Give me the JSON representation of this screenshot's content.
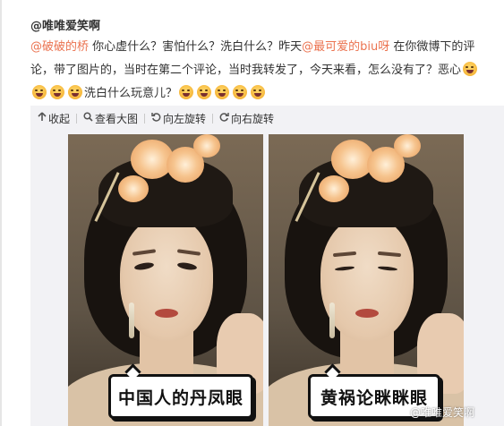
{
  "post": {
    "author": "@唯唯爱笑啊",
    "content": {
      "mention_1": "@破破的桥",
      "text_1": " 你心虚什么？害怕什么？洗白什么？昨天",
      "mention_2": "@最可爱的biu呀",
      "text_2": " 在你微博下的评论，带了图片的，当时在第二个评论，当时我转发了，今天来看，怎么没有了？恶心",
      "text_3": "洗白什么玩意儿？",
      "emoji_name": "vomit-face-emoji"
    }
  },
  "toolbar": {
    "collapse_label": "收起",
    "view_large_label": "查看大图",
    "rotate_left_label": "向左旋转",
    "rotate_right_label": "向右旋转",
    "icons": {
      "collapse": "collapse-icon",
      "zoom": "search-icon",
      "rotate_left": "rotate-left-icon",
      "rotate_right": "rotate-right-icon"
    }
  },
  "image": {
    "caption_left": "中国人的丹凤眼",
    "caption_right": "黄祸论眯眯眼",
    "watermark": "@唯唯爱笑啊"
  },
  "colors": {
    "mention": "#eb7350",
    "text": "#333333",
    "media_bg": "#f2f2f5"
  }
}
